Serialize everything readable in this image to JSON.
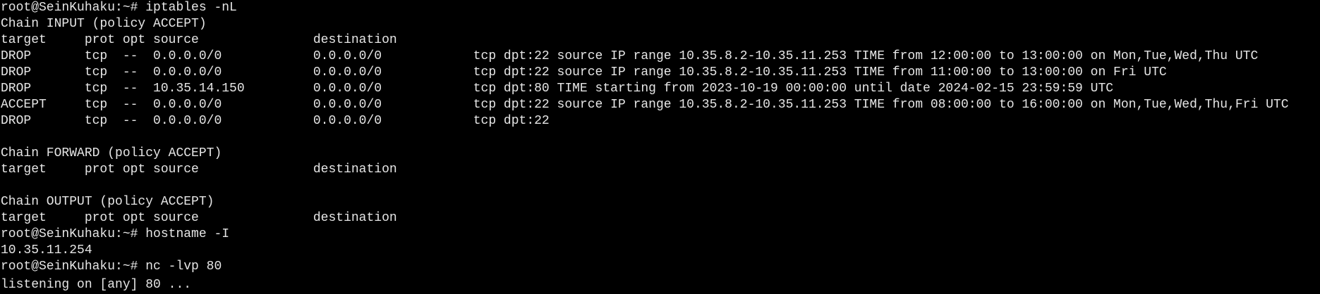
{
  "terminal": {
    "colors": {
      "background": "#000000",
      "foreground": "#e6e6e6"
    },
    "lines": [
      "root@SeinKuhaku:~# iptables -nL",
      "Chain INPUT (policy ACCEPT)",
      "target     prot opt source               destination",
      "DROP       tcp  --  0.0.0.0/0            0.0.0.0/0            tcp dpt:22 source IP range 10.35.8.2-10.35.11.253 TIME from 12:00:00 to 13:00:00 on Mon,Tue,Wed,Thu UTC",
      "DROP       tcp  --  0.0.0.0/0            0.0.0.0/0            tcp dpt:22 source IP range 10.35.8.2-10.35.11.253 TIME from 11:00:00 to 13:00:00 on Fri UTC",
      "DROP       tcp  --  10.35.14.150         0.0.0.0/0            tcp dpt:80 TIME starting from 2023-10-19 00:00:00 until date 2024-02-15 23:59:59 UTC",
      "ACCEPT     tcp  --  0.0.0.0/0            0.0.0.0/0            tcp dpt:22 source IP range 10.35.8.2-10.35.11.253 TIME from 08:00:00 to 16:00:00 on Mon,Tue,Wed,Thu,Fri UTC",
      "DROP       tcp  --  0.0.0.0/0            0.0.0.0/0            tcp dpt:22",
      "",
      "Chain FORWARD (policy ACCEPT)",
      "target     prot opt source               destination",
      "",
      "Chain OUTPUT (policy ACCEPT)",
      "target     prot opt source               destination",
      "root@SeinKuhaku:~# hostname -I",
      "10.35.11.254",
      "root@SeinKuhaku:~# nc -lvp 80",
      "listening on [any] 80 ..."
    ]
  }
}
